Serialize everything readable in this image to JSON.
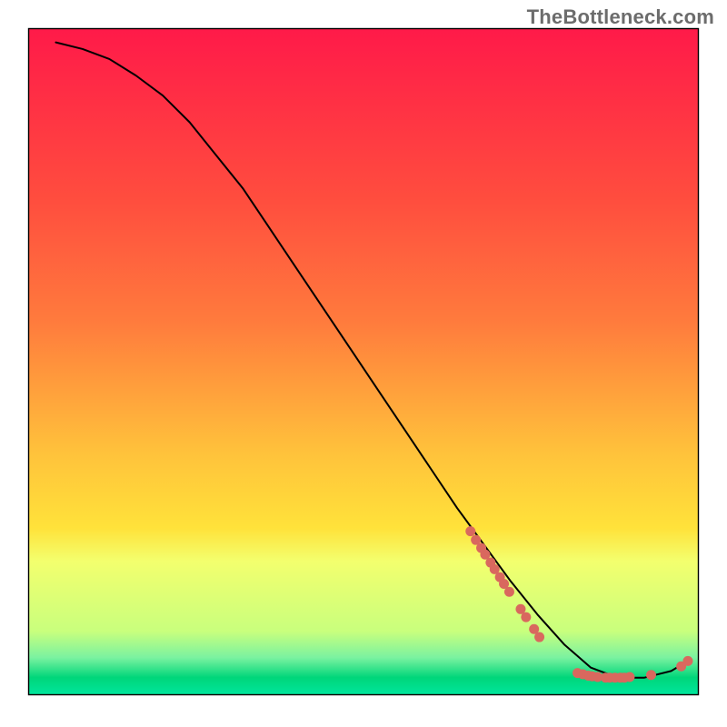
{
  "attribution": "TheBottleneck.com",
  "chart_data": {
    "type": "line",
    "title": "",
    "xlabel": "",
    "ylabel": "",
    "xlim": [
      0,
      100
    ],
    "ylim": [
      0,
      100
    ],
    "grid": false,
    "legend": false,
    "background_gradient": {
      "top": "#ff1a49",
      "mid1": "#ff7b3d",
      "mid2": "#ffe23a",
      "low": "#f3ff6e",
      "bottom": "#00d67a",
      "band_yellow_top": 76,
      "band_green_top": 90
    },
    "series": [
      {
        "name": "bottleneck-curve",
        "color": "#000000",
        "x": [
          4,
          8,
          12,
          16,
          20,
          24,
          28,
          32,
          36,
          40,
          44,
          48,
          52,
          56,
          60,
          64,
          68,
          72,
          76,
          80,
          84,
          88,
          92,
          96,
          98.5
        ],
        "y": [
          98,
          97,
          95.5,
          93,
          90,
          86,
          81,
          76,
          70,
          64,
          58,
          52,
          46,
          40,
          34,
          28,
          22.5,
          17,
          12,
          7.5,
          4,
          2.5,
          2.5,
          3.5,
          5
        ]
      }
    ],
    "marker_clusters": [
      {
        "name": "upper-slope-points",
        "color": "#d9685e",
        "points": [
          {
            "x": 66.0,
            "y": 24.5
          },
          {
            "x": 66.8,
            "y": 23.2
          },
          {
            "x": 67.6,
            "y": 22.0
          },
          {
            "x": 68.2,
            "y": 21.0
          },
          {
            "x": 69.0,
            "y": 19.8
          },
          {
            "x": 69.6,
            "y": 18.8
          },
          {
            "x": 70.4,
            "y": 17.6
          },
          {
            "x": 71.0,
            "y": 16.6
          },
          {
            "x": 71.8,
            "y": 15.4
          },
          {
            "x": 73.5,
            "y": 12.8
          },
          {
            "x": 74.3,
            "y": 11.6
          },
          {
            "x": 75.5,
            "y": 9.8
          },
          {
            "x": 76.3,
            "y": 8.6
          }
        ]
      },
      {
        "name": "valley-points",
        "color": "#d9685e",
        "points": [
          {
            "x": 82.0,
            "y": 3.2
          },
          {
            "x": 82.8,
            "y": 3.0
          },
          {
            "x": 83.6,
            "y": 2.8
          },
          {
            "x": 84.2,
            "y": 2.7
          },
          {
            "x": 85.0,
            "y": 2.6
          },
          {
            "x": 86.2,
            "y": 2.5
          },
          {
            "x": 86.8,
            "y": 2.5
          },
          {
            "x": 87.6,
            "y": 2.5
          },
          {
            "x": 88.4,
            "y": 2.5
          },
          {
            "x": 89.0,
            "y": 2.5
          },
          {
            "x": 89.8,
            "y": 2.6
          },
          {
            "x": 93.0,
            "y": 2.9
          }
        ]
      },
      {
        "name": "rise-points",
        "color": "#d9685e",
        "points": [
          {
            "x": 97.5,
            "y": 4.2
          },
          {
            "x": 98.5,
            "y": 5.0
          }
        ]
      }
    ]
  }
}
